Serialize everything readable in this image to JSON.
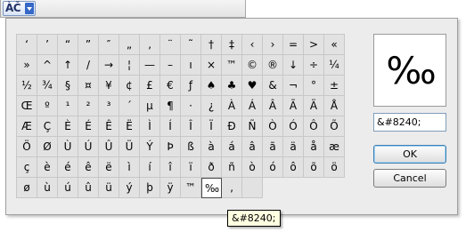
{
  "toolbar": {
    "font_button_label": "ÀČ"
  },
  "characters": [
    "‘",
    "’",
    "“",
    "”",
    "″",
    "„",
    "‚",
    "¨",
    "˜",
    "†",
    "‡",
    "‹",
    "›",
    "=",
    ">",
    "«",
    "»",
    "^",
    "↑",
    "/",
    "→",
    "¦",
    "—",
    "–",
    "ı",
    "×",
    "™",
    "©",
    "®",
    "↓",
    "÷",
    "¼",
    "½",
    "¾",
    "§",
    "¤",
    "¥",
    "¢",
    "£",
    "€",
    "ƒ",
    "♠",
    "♣",
    "♥",
    "&",
    "¬",
    "°",
    "±",
    "Œ",
    "º",
    "¹",
    "²",
    "³",
    "´",
    "µ",
    "¶",
    "·",
    "¿",
    "À",
    "Á",
    "Â",
    "Ã",
    "Ä",
    "Å",
    "Æ",
    "Ç",
    "È",
    "É",
    "Ê",
    "Ë",
    "Ì",
    "Í",
    "Î",
    "Ï",
    "Ð",
    "Ñ",
    "Ò",
    "Ó",
    "Ô",
    "Õ",
    "Ö",
    "Ø",
    "Ù",
    "Ú",
    "Û",
    "Ü",
    "Ý",
    "Þ",
    "ß",
    "à",
    "á",
    "â",
    "ã",
    "ä",
    "å",
    "æ",
    "ç",
    "è",
    "é",
    "ê",
    "ë",
    "ì",
    "í",
    "î",
    "ï",
    "ð",
    "ñ",
    "ò",
    "ó",
    "ô",
    "õ",
    "ö",
    "ø",
    "ù",
    "ú",
    "û",
    "ü",
    "ý",
    "þ",
    "ÿ",
    "™",
    "‰",
    "‚",
    ""
  ],
  "selected_index": 121,
  "preview": {
    "glyph": "‰"
  },
  "code_field": {
    "value": "&#8240;"
  },
  "buttons": {
    "ok_label": "OK",
    "cancel_label": "Cancel"
  },
  "tooltip": {
    "text": "&#8240;"
  }
}
